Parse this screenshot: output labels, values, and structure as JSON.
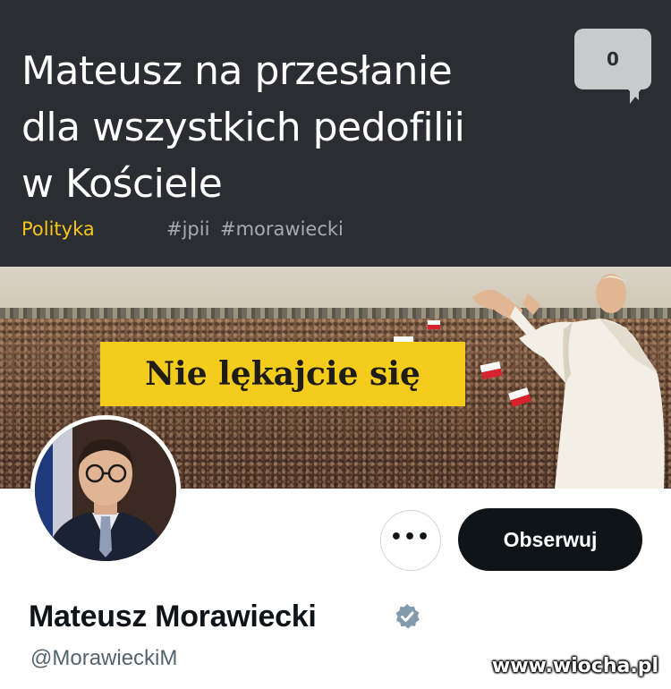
{
  "article": {
    "title": "Mateusz na przesłanie\ndla wszystkich pedofilii\nw Kościele",
    "comment_count": "0",
    "category": "Polityka",
    "tags": [
      "#jpii",
      "#morawiecki"
    ]
  },
  "banner": {
    "sign_text": "Nie lękajcie się"
  },
  "profile": {
    "more_label": "•••",
    "follow_label": "Obserwuj",
    "display_name": "Mateusz Morawiecki",
    "handle": "@MorawieckiM",
    "verified_icon": "verified-badge-icon"
  },
  "watermark": "www.wiocha.pl",
  "colors": {
    "header_bg": "#2b2d33",
    "category": "#f5c518",
    "tag": "#a8aab0",
    "sign_bg": "#f4cc1c",
    "follow_bg": "#0f1419",
    "handle": "#536471",
    "verified": "#829aab"
  }
}
